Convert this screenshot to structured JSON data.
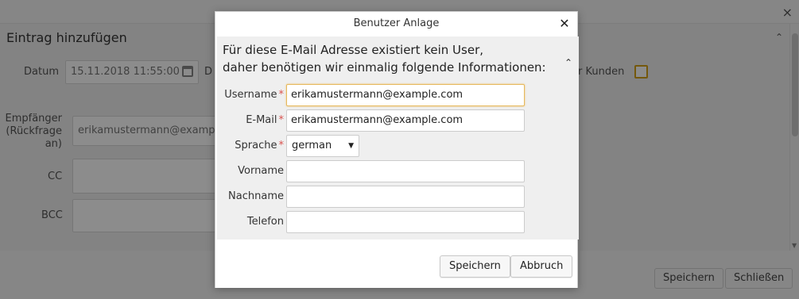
{
  "background": {
    "title": "Eintrag hinzufügen",
    "datum_label": "Datum",
    "datum_value": "15.11.2018 11:55:00",
    "datum_suffix": "D",
    "kunden_label": "r Kunden",
    "empfaenger_label_line1": "Empfänger",
    "empfaenger_label_line2": "(Rückfrage",
    "empfaenger_label_line3": "an)",
    "empfaenger_value": "erikamustermann@examp",
    "cc_label": "CC",
    "bcc_label": "BCC",
    "save_label": "Speichern",
    "close_label": "Schließen",
    "close_icon": "×",
    "collapse_icon": "⌃"
  },
  "modal": {
    "title": "Benutzer Anlage",
    "close_icon": "✕",
    "section_title_line1": "Für diese E-Mail Adresse existiert kein User,",
    "section_title_line2": "daher benötigen wir einmalig folgende Informationen:",
    "section_toggle_icon": "⌃",
    "fields": {
      "username": {
        "label": "Username",
        "value": "erikamustermann@example.com",
        "required": "*"
      },
      "email": {
        "label": "E-Mail",
        "value": "erikamustermann@example.com",
        "required": "*"
      },
      "sprache": {
        "label": "Sprache",
        "value": "german",
        "required": "*"
      },
      "vorname": {
        "label": "Vorname",
        "value": ""
      },
      "nachname": {
        "label": "Nachname",
        "value": ""
      },
      "telefon": {
        "label": "Telefon",
        "value": ""
      }
    },
    "select_arrow": "▼",
    "save_label": "Speichern",
    "cancel_label": "Abbruch"
  },
  "colors": {
    "required": "#d9534f",
    "focus_border": "#e6b85c",
    "checkbox_border": "#d4a017"
  }
}
